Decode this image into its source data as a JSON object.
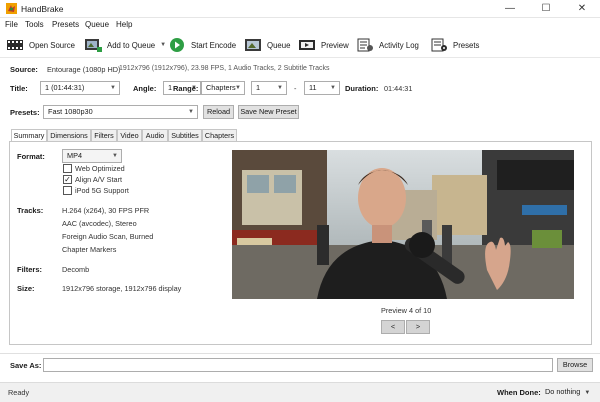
{
  "window": {
    "title": "HandBrake",
    "minimize": "—",
    "maximize": "☐",
    "close": "✕"
  },
  "menu": [
    "File",
    "Tools",
    "Presets",
    "Queue",
    "Help"
  ],
  "toolbar": {
    "open_source": "Open Source",
    "add_to_queue": "Add to Queue",
    "start_encode": "Start Encode",
    "queue": "Queue",
    "preview": "Preview",
    "activity_log": "Activity Log",
    "presets": "Presets"
  },
  "source": {
    "label": "Source:",
    "name": "Entourage (1080p HD)",
    "details": "1912x796 (1912x796), 23.98 FPS, 1 Audio Tracks, 2 Subtitle Tracks"
  },
  "title_row": {
    "title_label": "Title:",
    "title_value": "1 (01:44:31)",
    "angle_label": "Angle:",
    "angle_value": "1",
    "range_label": "Range:",
    "range_mode": "Chapters",
    "range_start": "1",
    "range_sep": "-",
    "range_end": "11",
    "duration_label": "Duration:",
    "duration_value": "01:44:31"
  },
  "presets_row": {
    "label": "Presets:",
    "value": "Fast 1080p30",
    "reload": "Reload",
    "save_new": "Save New Preset"
  },
  "tabs": [
    "Summary",
    "Dimensions",
    "Filters",
    "Video",
    "Audio",
    "Subtitles",
    "Chapters"
  ],
  "summary": {
    "format_label": "Format:",
    "format_value": "MP4",
    "web_optimized": "Web Optimized",
    "web_optimized_checked": false,
    "align_av": "Align A/V Start",
    "align_av_checked": true,
    "ipod": "iPod 5G Support",
    "ipod_checked": false,
    "tracks_label": "Tracks:",
    "tracks": [
      "H.264 (x264), 30 FPS PFR",
      "AAC (avcodec), Stereo",
      "Foreign Audio Scan, Burned",
      "Chapter Markers"
    ],
    "filters_label": "Filters:",
    "filters_value": "Decomb",
    "size_label": "Size:",
    "size_value": "1912x796 storage, 1912x796 display"
  },
  "preview_panel": {
    "caption": "Preview 4 of 10",
    "prev": "<",
    "next": ">"
  },
  "save_as": {
    "label": "Save As:",
    "value": "",
    "browse": "Browse"
  },
  "status": {
    "text": "Ready",
    "when_done_label": "When Done:",
    "when_done_value": "Do nothing"
  },
  "colors": {
    "accent": "#2e9e44",
    "background": "#ffffff",
    "panel_border": "#c6c6c6"
  },
  "icons": [
    "handbrake-logo-icon",
    "film-open-icon",
    "add-queue-icon",
    "play-icon",
    "queue-icon",
    "preview-icon",
    "activity-log-icon",
    "presets-icon"
  ]
}
